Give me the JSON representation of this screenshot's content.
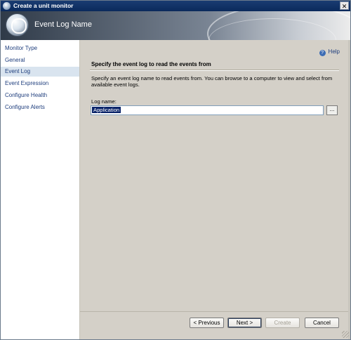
{
  "window": {
    "title": "Create a unit monitor",
    "close_label": "✕"
  },
  "header": {
    "title": "Event Log Name"
  },
  "sidebar": {
    "items": [
      {
        "label": "Monitor Type"
      },
      {
        "label": "General"
      },
      {
        "label": "Event Log"
      },
      {
        "label": "Event Expression"
      },
      {
        "label": "Configure Health"
      },
      {
        "label": "Configure Alerts"
      }
    ]
  },
  "content": {
    "help": {
      "label": "Help",
      "icon": "help-icon"
    },
    "section_title": "Specify the event log to read the events from",
    "description": "Specify an event log name to read events from. You can browse to a computer to view and select from available event logs.",
    "log_name_label": "Log name:",
    "log_name_value": "Application",
    "browse_label": "..."
  },
  "footer": {
    "previous": "< Previous",
    "next": "Next >",
    "create": "Create",
    "cancel": "Cancel"
  }
}
